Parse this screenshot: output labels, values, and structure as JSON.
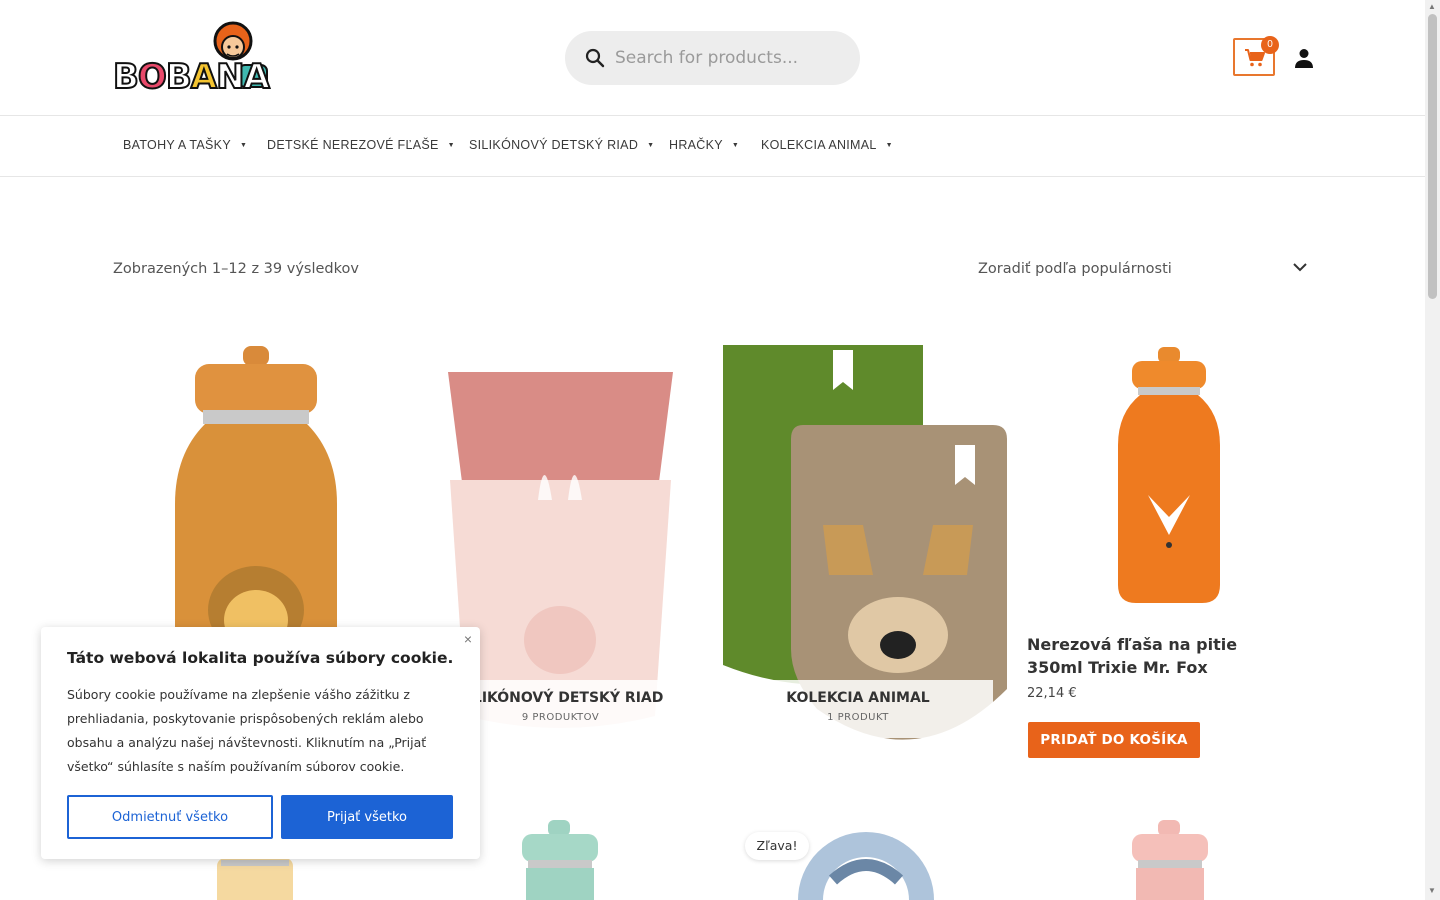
{
  "header": {
    "logo_text": "BOBANA",
    "search_placeholder": "Search for products...",
    "cart_count": "0"
  },
  "nav": {
    "items": [
      {
        "label": "BATOHY A TAŠKY"
      },
      {
        "label": "DETSKÉ NEREZOVÉ FĽAŠE"
      },
      {
        "label": "SILIKÓNOVÝ DETSKÝ RIAD"
      },
      {
        "label": "HRAČKY"
      },
      {
        "label": "KOLEKCIA ANIMAL"
      }
    ]
  },
  "toolbar": {
    "results_text": "Zobrazených 1–12 z 39 výsledkov",
    "sort_label": "Zoradiť podľa populárnosti"
  },
  "categories": [
    {
      "title": "SILIKÓNOVÝ DETSKÝ RIAD",
      "count": "9 PRODUKTOV"
    },
    {
      "title": "KOLEKCIA ANIMAL",
      "count": "1 PRODUKT"
    }
  ],
  "product": {
    "title": "Nerezová fľaša na pitie 350ml Trixie Mr. Fox",
    "price": "22,14 €",
    "add_to_cart": "PRIDAŤ DO KOŠÍKA"
  },
  "sale_badge": "Zľava!",
  "cookie": {
    "title": "Táto webová lokalita používa súbory cookie.",
    "text": "Súbory cookie používame na zlepšenie vášho zážitku z prehliadania, poskytovanie prispôsobených reklám alebo obsahu a analýzu našej návštevnosti. Kliknutím na „Prijať všetko“ súhlasíte s naším používaním súborov cookie.",
    "reject": "Odmietnuť všetko",
    "accept": "Prijať všetko",
    "close": "×"
  },
  "colors": {
    "accent_orange": "#e8631a",
    "cookie_blue": "#1c63d5"
  }
}
